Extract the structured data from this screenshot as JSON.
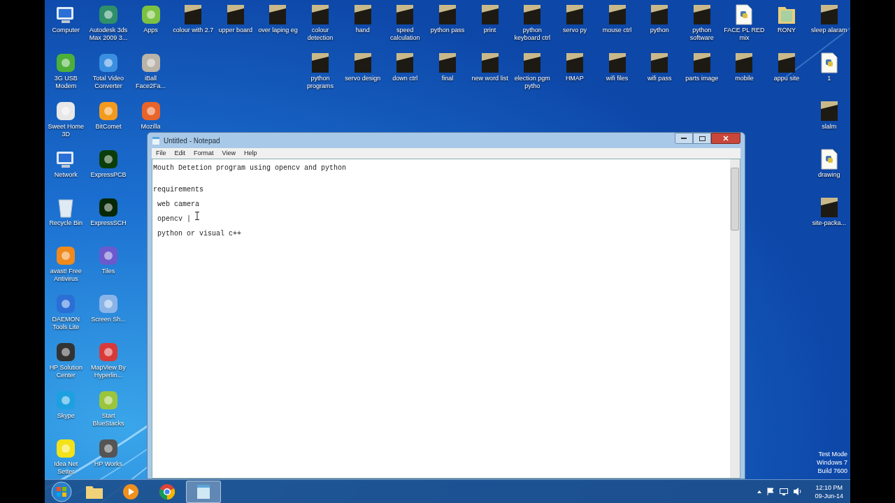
{
  "desktop_icons": [
    {
      "left": [
        {
          "label": "Computer",
          "kind": "computer"
        },
        {
          "label": "Autodesk 3ds Max 2009 3...",
          "kind": "app",
          "color": "#2f8f6a"
        },
        {
          "label": "Apps",
          "kind": "app",
          "color": "#7cc242"
        },
        {
          "label": "colour with 2.7",
          "kind": "file"
        },
        {
          "label": "upper board",
          "kind": "file"
        },
        {
          "label": "over laping eg",
          "kind": "file"
        },
        {
          "label": "colour detection",
          "kind": "file"
        },
        {
          "label": "hand",
          "kind": "file"
        },
        {
          "label": "speed calculation",
          "kind": "file"
        },
        {
          "label": "python pass",
          "kind": "file"
        },
        {
          "label": "print",
          "kind": "file"
        },
        {
          "label": "python keyboard ctrl",
          "kind": "file"
        },
        {
          "label": "servo py",
          "kind": "file"
        },
        {
          "label": "mouse ctrl",
          "kind": "file"
        },
        {
          "label": "python",
          "kind": "file"
        },
        {
          "label": "python software",
          "kind": "file"
        },
        {
          "label": "FACE PL RED mix",
          "kind": "script"
        },
        {
          "label": "RONY",
          "kind": "folder"
        },
        {
          "label": "sleep alaram",
          "kind": "file"
        }
      ]
    },
    {
      "left": [
        {
          "label": "3G USB Modem",
          "kind": "app",
          "color": "#4caf3a"
        },
        {
          "label": "Total Video Converter",
          "kind": "app",
          "color": "#3a8fe0"
        },
        {
          "label": "iBall Face2Fa...",
          "kind": "app",
          "color": "#b9b3a8"
        }
      ],
      "right": [
        {
          "label": "python programs",
          "kind": "file"
        },
        {
          "label": "servo design",
          "kind": "file"
        },
        {
          "label": "down ctrl",
          "kind": "file"
        },
        {
          "label": "final",
          "kind": "file"
        },
        {
          "label": "new word list",
          "kind": "file"
        },
        {
          "label": "election pgm pytho",
          "kind": "file"
        },
        {
          "label": "HMAP",
          "kind": "file"
        },
        {
          "label": "wifi files",
          "kind": "file"
        },
        {
          "label": "wifi pass",
          "kind": "file"
        },
        {
          "label": "parts image",
          "kind": "file"
        },
        {
          "label": "mobile",
          "kind": "file"
        },
        {
          "label": "appu site",
          "kind": "file"
        },
        {
          "label": "1",
          "kind": "script"
        }
      ]
    },
    {
      "left": [
        {
          "label": "Sweet Home 3D",
          "kind": "app",
          "color": "#e8e8e8"
        },
        {
          "label": "BitComet",
          "kind": "app",
          "color": "#f39a1e"
        },
        {
          "label": "Mozilla",
          "kind": "app",
          "color": "#e8642a"
        }
      ],
      "right": [
        {
          "label": "slalm",
          "kind": "file"
        }
      ]
    },
    {
      "left": [
        {
          "label": "Network",
          "kind": "computer"
        },
        {
          "label": "ExpressPCB",
          "kind": "app",
          "color": "#0b3d0b"
        }
      ],
      "right": [
        {
          "label": "drawing",
          "kind": "script"
        }
      ]
    },
    {
      "left": [
        {
          "label": "Recycle Bin",
          "kind": "bin"
        },
        {
          "label": "ExpressSCH",
          "kind": "app",
          "color": "#062806"
        }
      ],
      "right": [
        {
          "label": "site-packa...",
          "kind": "file"
        }
      ]
    },
    {
      "left": [
        {
          "label": "avast! Free Antivirus",
          "kind": "app",
          "color": "#f08a1c"
        },
        {
          "label": "Tiles",
          "kind": "app",
          "color": "#6a5acd"
        }
      ]
    },
    {
      "left": [
        {
          "label": "DAEMON Tools Lite",
          "kind": "app",
          "color": "#2b6fd6"
        },
        {
          "label": "Screen Sh...",
          "kind": "app",
          "color": "#8ab4e8"
        }
      ]
    },
    {
      "left": [
        {
          "label": "HP Solution Center",
          "kind": "app",
          "color": "#333333"
        },
        {
          "label": "MapView By Hyperlin...",
          "kind": "app",
          "color": "#d83a3a"
        }
      ]
    },
    {
      "left": [
        {
          "label": "Skype",
          "kind": "app",
          "color": "#1ea0e0"
        },
        {
          "label": "Start BlueStacks",
          "kind": "app",
          "color": "#9bc53d"
        }
      ]
    },
    {
      "left": [
        {
          "label": "Idea Net Setter",
          "kind": "app",
          "color": "#f2e21a"
        },
        {
          "label": "HP Works",
          "kind": "app",
          "color": "#555555"
        }
      ]
    }
  ],
  "notepad": {
    "title": "Untitled - Notepad",
    "menu": [
      "File",
      "Edit",
      "Format",
      "View",
      "Help"
    ],
    "heading": "Mouth Detetion program using opencv and python",
    "lines": [
      "requirements",
      " web camera",
      " opencv | ",
      " python or visual c++"
    ]
  },
  "os_notice": [
    "Test Mode",
    "Windows 7",
    "Build 7600"
  ],
  "taskbar": {
    "apps": [
      {
        "kind": "explorer",
        "selected": false
      },
      {
        "kind": "media",
        "selected": false
      },
      {
        "kind": "chrome",
        "selected": false
      },
      {
        "kind": "notepad",
        "selected": true
      }
    ],
    "time": "12:10 PM",
    "date": "09-Jun-14"
  }
}
